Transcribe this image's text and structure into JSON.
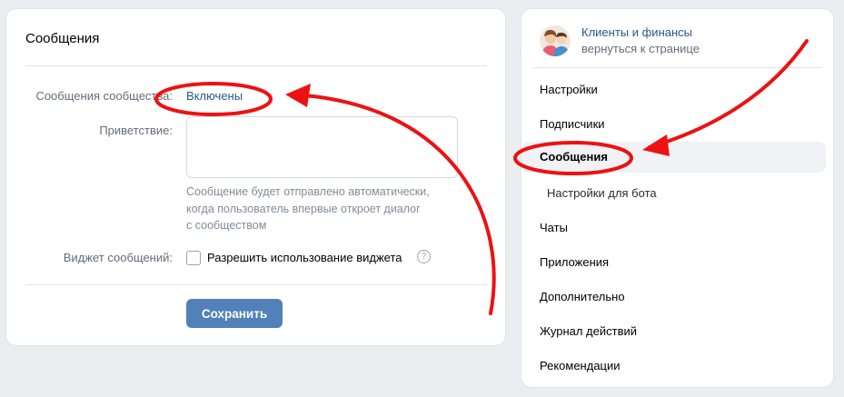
{
  "main": {
    "title": "Сообщения",
    "community_messages_label": "Сообщения сообщества:",
    "community_messages_value": "Включены",
    "greeting_label": "Приветствие:",
    "greeting_value": "",
    "hint_lines": [
      "Сообщение будет отправлено автоматически,",
      "когда пользователь впервые откроет диалог",
      "с сообществом"
    ],
    "widget_label": "Виджет сообщений:",
    "widget_checkbox_label": "Разрешить использование виджета",
    "widget_checked": false,
    "help_icon": "?",
    "save_label": "Сохранить"
  },
  "sidebar": {
    "group_name": "Клиенты и финансы",
    "group_back": "вернуться к странице",
    "items": [
      {
        "label": "Настройки"
      },
      {
        "label": "Подписчики"
      },
      {
        "label": "Сообщения",
        "active": true
      },
      {
        "label": "Настройки для бота",
        "sub": true
      },
      {
        "label": "Чаты"
      },
      {
        "label": "Приложения"
      },
      {
        "label": "Дополнительно"
      },
      {
        "label": "Журнал действий"
      },
      {
        "label": "Рекомендации"
      }
    ]
  },
  "colors": {
    "accent": "#5181b8",
    "link": "#2a5885",
    "annotation": "#ee1111",
    "background": "#ebedf0"
  }
}
